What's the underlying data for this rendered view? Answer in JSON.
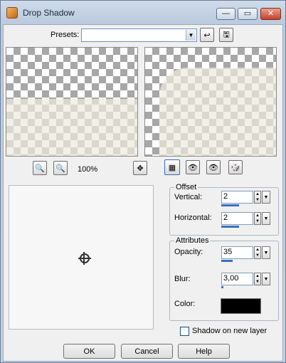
{
  "window": {
    "title": "Drop Shadow",
    "minimize_glyph": "—",
    "maximize_glyph": "▭",
    "close_glyph": "✕"
  },
  "presets": {
    "label": "Presets:",
    "value": "",
    "arrow_glyph": "▼"
  },
  "toolbar": {
    "load_icon": "undo-arrow-icon",
    "save_icon": "floppy-disk-icon",
    "load_glyph": "↩",
    "save_glyph": "🖫"
  },
  "zoom": {
    "level": "100%",
    "zoom_out_glyph": "🔍",
    "zoom_in_glyph": "🔍",
    "pan_glyph": "✥",
    "proof_glyph": "▦",
    "mode1_glyph": "👁",
    "mode2_glyph": "👁",
    "reset_glyph": "🎲"
  },
  "offset": {
    "title": "Offset",
    "vertical_label": "Vertical:",
    "vertical_value": "2",
    "vertical_level": 0.55,
    "horizontal_label": "Horizontal:",
    "horizontal_value": "2",
    "horizontal_level": 0.55
  },
  "attributes": {
    "title": "Attributes",
    "opacity_label": "Opacity:",
    "opacity_value": "35",
    "opacity_level": 0.35,
    "blur_label": "Blur:",
    "blur_value": "3,00",
    "blur_level": 0.05,
    "color_label": "Color:",
    "color_hex": "#000000"
  },
  "shadow_new_layer": {
    "label": "Shadow on new layer",
    "checked": false
  },
  "buttons": {
    "ok": "OK",
    "cancel": "Cancel",
    "help": "Help"
  },
  "spin": {
    "up": "▲",
    "down": "▼",
    "drop": "▼"
  }
}
